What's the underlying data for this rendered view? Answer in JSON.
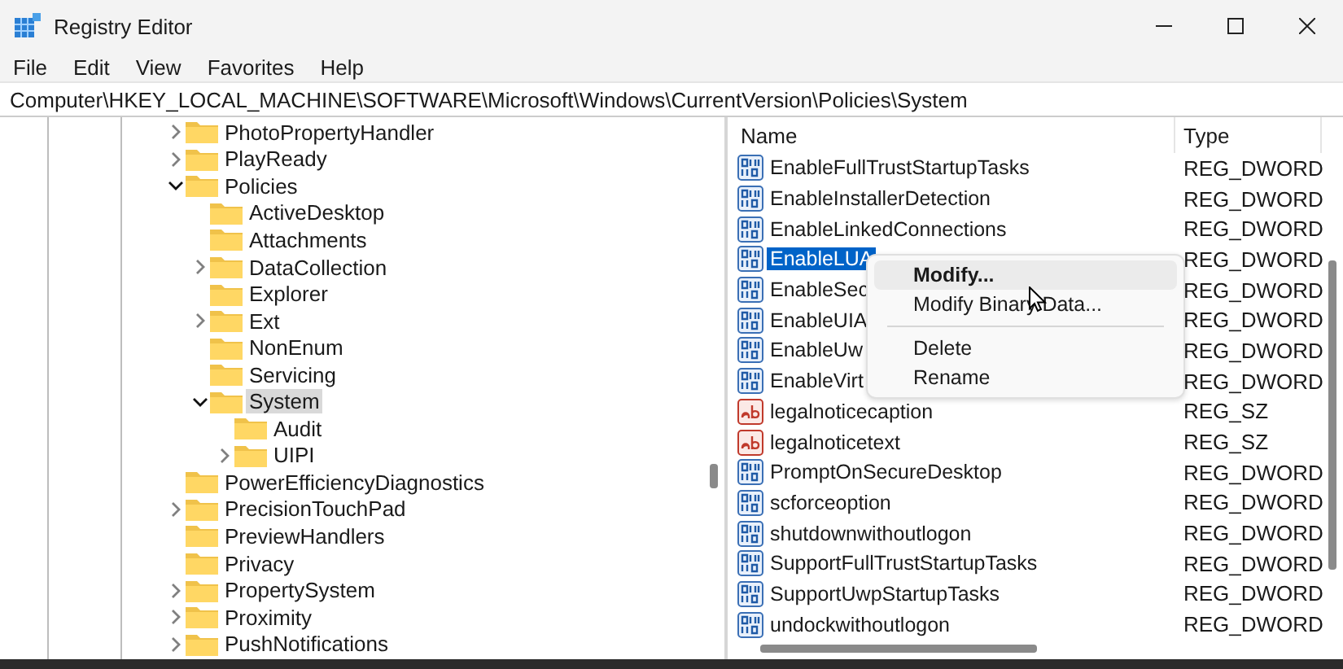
{
  "window": {
    "title": "Registry Editor"
  },
  "menu": [
    "File",
    "Edit",
    "View",
    "Favorites",
    "Help"
  ],
  "address": "Computer\\HKEY_LOCAL_MACHINE\\SOFTWARE\\Microsoft\\Windows\\CurrentVersion\\Policies\\System",
  "tree": [
    {
      "label": "PhotoPropertyHandler",
      "kind": "branch",
      "expanded": false,
      "selected": false
    },
    {
      "label": "PlayReady",
      "kind": "branch",
      "expanded": false,
      "selected": false
    },
    {
      "label": "Policies",
      "kind": "branch",
      "expanded": true,
      "selected": false,
      "children": [
        {
          "label": "ActiveDesktop",
          "kind": "leaf",
          "selected": false
        },
        {
          "label": "Attachments",
          "kind": "leaf",
          "selected": false
        },
        {
          "label": "DataCollection",
          "kind": "branch",
          "expanded": false,
          "selected": false
        },
        {
          "label": "Explorer",
          "kind": "leaf",
          "selected": false
        },
        {
          "label": "Ext",
          "kind": "branch",
          "expanded": false,
          "selected": false
        },
        {
          "label": "NonEnum",
          "kind": "leaf",
          "selected": false
        },
        {
          "label": "Servicing",
          "kind": "leaf",
          "selected": false
        },
        {
          "label": "System",
          "kind": "branch",
          "expanded": true,
          "selected": true,
          "children": [
            {
              "label": "Audit",
              "kind": "leaf",
              "selected": false
            },
            {
              "label": "UIPI",
              "kind": "branch",
              "expanded": false,
              "selected": false
            }
          ]
        }
      ]
    },
    {
      "label": "PowerEfficiencyDiagnostics",
      "kind": "leaf",
      "selected": false
    },
    {
      "label": "PrecisionTouchPad",
      "kind": "branch",
      "expanded": false,
      "selected": false
    },
    {
      "label": "PreviewHandlers",
      "kind": "leaf",
      "selected": false
    },
    {
      "label": "Privacy",
      "kind": "leaf",
      "selected": false
    },
    {
      "label": "PropertySystem",
      "kind": "branch",
      "expanded": false,
      "selected": false
    },
    {
      "label": "Proximity",
      "kind": "branch",
      "expanded": false,
      "selected": false
    },
    {
      "label": "PushNotifications",
      "kind": "branch",
      "expanded": false,
      "selected": false
    }
  ],
  "table": {
    "columns": [
      "Name",
      "Type"
    ],
    "rows": [
      {
        "name": "EnableFullTrustStartupTasks",
        "type": "REG_DWORD",
        "kind": "binary",
        "selected": false
      },
      {
        "name": "EnableInstallerDetection",
        "type": "REG_DWORD",
        "kind": "binary",
        "selected": false
      },
      {
        "name": "EnableLinkedConnections",
        "type": "REG_DWORD",
        "kind": "binary",
        "selected": false
      },
      {
        "name": "EnableLUA",
        "type": "REG_DWORD",
        "kind": "binary",
        "selected": true
      },
      {
        "name": "EnableSec",
        "type": "REG_DWORD",
        "kind": "binary",
        "selected": false
      },
      {
        "name": "EnableUIA",
        "type": "REG_DWORD",
        "kind": "binary",
        "selected": false
      },
      {
        "name": "EnableUw",
        "type": "REG_DWORD",
        "kind": "binary",
        "selected": false
      },
      {
        "name": "EnableVirt",
        "type": "REG_DWORD",
        "kind": "binary",
        "selected": false
      },
      {
        "name": "legalnoticecaption",
        "type": "REG_SZ",
        "kind": "string",
        "selected": false
      },
      {
        "name": "legalnoticetext",
        "type": "REG_SZ",
        "kind": "string",
        "selected": false
      },
      {
        "name": "PromptOnSecureDesktop",
        "type": "REG_DWORD",
        "kind": "binary",
        "selected": false
      },
      {
        "name": "scforceoption",
        "type": "REG_DWORD",
        "kind": "binary",
        "selected": false
      },
      {
        "name": "shutdownwithoutlogon",
        "type": "REG_DWORD",
        "kind": "binary",
        "selected": false
      },
      {
        "name": "SupportFullTrustStartupTasks",
        "type": "REG_DWORD",
        "kind": "binary",
        "selected": false
      },
      {
        "name": "SupportUwpStartupTasks",
        "type": "REG_DWORD",
        "kind": "binary",
        "selected": false
      },
      {
        "name": "undockwithoutlogon",
        "type": "REG_DWORD",
        "kind": "binary",
        "selected": false
      }
    ]
  },
  "context_menu": [
    {
      "kind": "item",
      "label": "Modify...",
      "default": true,
      "selected": true
    },
    {
      "kind": "item",
      "label": "Modify Binary Data...",
      "default": false,
      "selected": false
    },
    {
      "kind": "separator"
    },
    {
      "kind": "item",
      "label": "Delete",
      "default": false,
      "selected": false
    },
    {
      "kind": "item",
      "label": "Rename",
      "default": false,
      "selected": false
    }
  ]
}
